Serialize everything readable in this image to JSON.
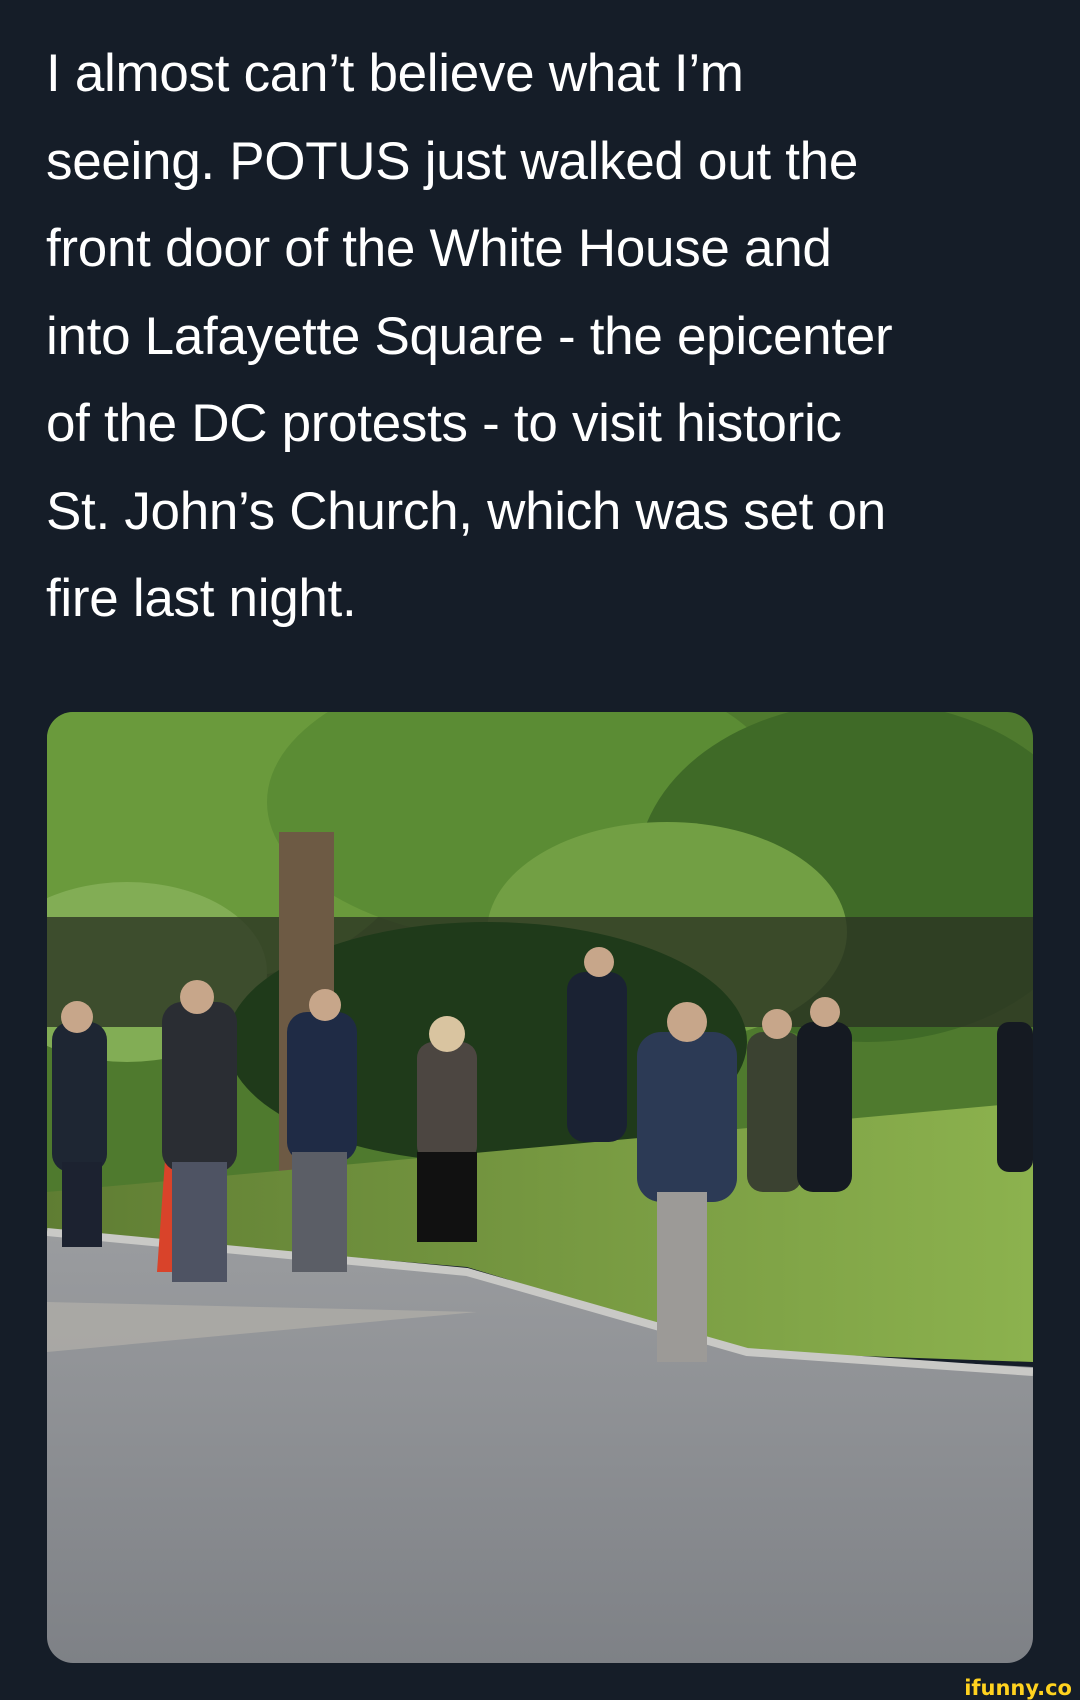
{
  "tweet": {
    "text": "I almost can’t believe what I’m\nseeing. POTUS just walked out the\nfront door of the White House and\ninto Lafayette Square - the epicenter\nof the DC protests - to visit historic\nSt. John’s Church, which was set on\nfire last night."
  },
  "media": {
    "icon": "photo-image",
    "description_colors": {
      "sky_trees": "#5d8a3a",
      "grass": "#7fa645",
      "road": "#8e9196"
    }
  },
  "watermark": {
    "text": "ifunny.co",
    "color": "#ffd21f"
  },
  "colors": {
    "background": "#151d28",
    "text": "#ffffff"
  }
}
